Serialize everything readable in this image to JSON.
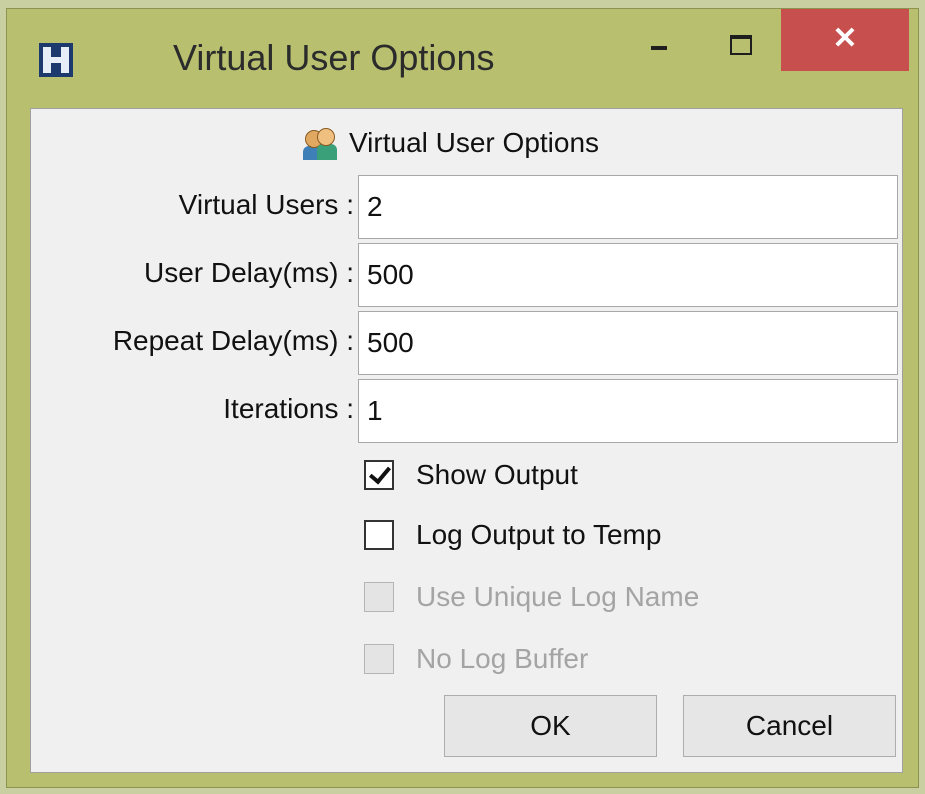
{
  "window": {
    "title": "Virtual User Options",
    "close_glyph": "✕"
  },
  "header": {
    "text": "Virtual User Options",
    "icon": "users-icon"
  },
  "fields": [
    {
      "label": "Virtual Users :",
      "value": "2"
    },
    {
      "label": "User Delay(ms) :",
      "value": "500"
    },
    {
      "label": "Repeat Delay(ms) :",
      "value": "500"
    },
    {
      "label": "Iterations :",
      "value": "1"
    }
  ],
  "checkboxes": [
    {
      "label": "Show Output",
      "checked": true,
      "enabled": true
    },
    {
      "label": "Log Output to Temp",
      "checked": false,
      "enabled": true
    },
    {
      "label": "Use Unique Log Name",
      "checked": false,
      "enabled": false
    },
    {
      "label": "No Log Buffer",
      "checked": false,
      "enabled": false
    }
  ],
  "buttons": {
    "ok": "OK",
    "cancel": "Cancel"
  },
  "colors": {
    "frame": "#b8c070",
    "close": "#c7504f",
    "client": "#f0f0f0"
  }
}
